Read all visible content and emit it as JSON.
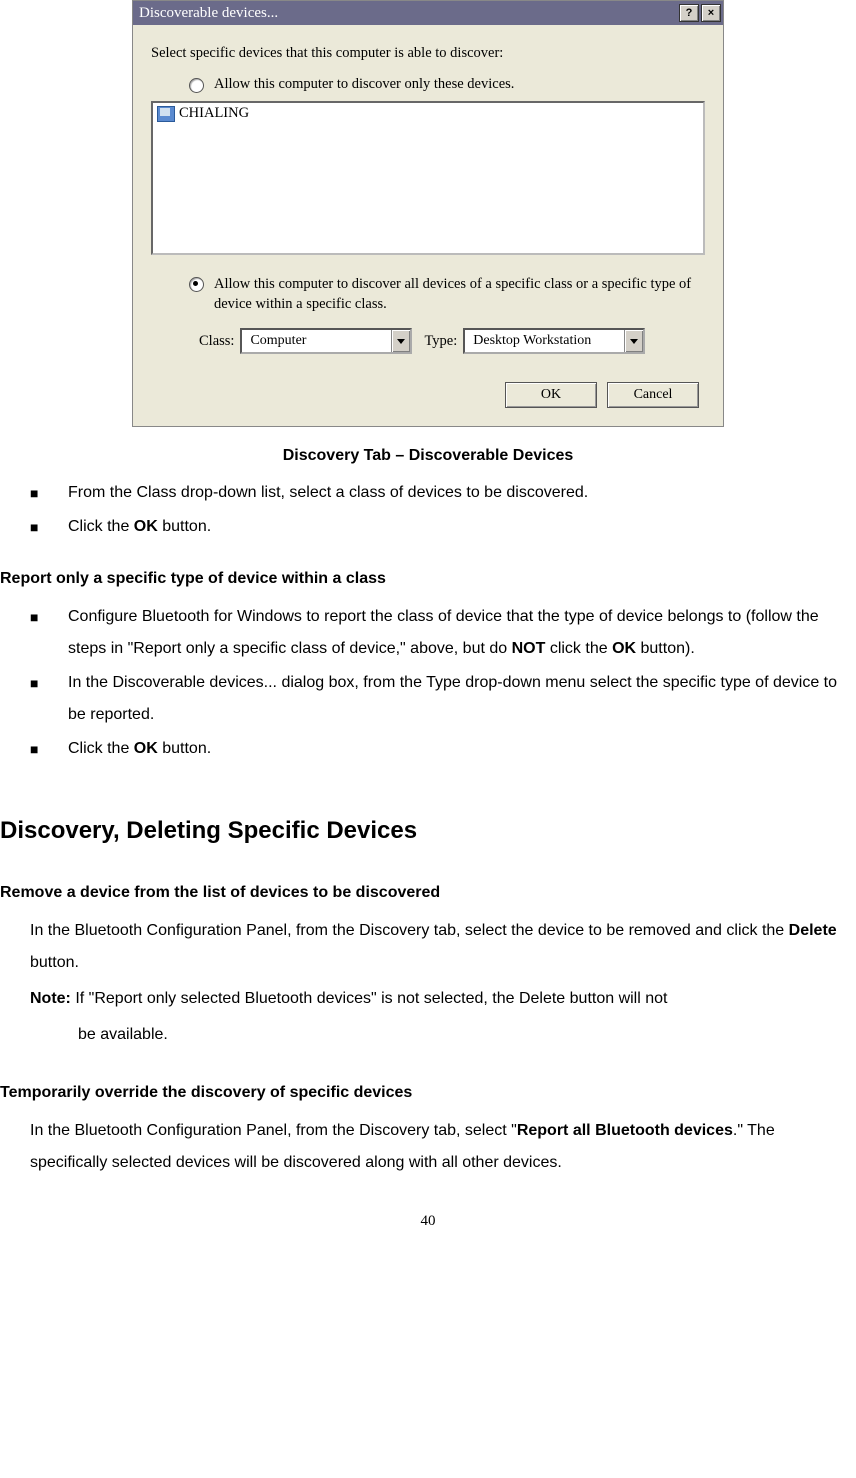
{
  "dialog": {
    "title": "Discoverable devices...",
    "help_btn": "?",
    "close_btn": "×",
    "instruction": "Select specific devices that this computer is able to discover:",
    "radio1": "Allow this computer to discover only these devices.",
    "device1": "CHIALING",
    "radio2": "Allow this computer to discover all devices of a specific class or a specific type of device within a specific class.",
    "class_label": "Class:",
    "class_value": "Computer",
    "type_label": "Type:",
    "type_value": "Desktop Workstation",
    "ok": "OK",
    "cancel": "Cancel"
  },
  "caption": "Discovery Tab – Discoverable Devices",
  "list1": {
    "item1": "From the Class drop-down list, select a class of devices to be discovered.",
    "item2_pre": "Click the ",
    "item2_bold": "OK",
    "item2_post": " button."
  },
  "subhead1": "Report only a specific type of device within a class",
  "list2": {
    "item1_pre": "Configure Bluetooth for Windows to report the class of device that the type of device belongs to (follow the steps in \"Report only a specific class of device,\" above, but do ",
    "item1_not": "NOT",
    "item1_mid": " click the ",
    "item1_ok": "OK",
    "item1_post": " button).",
    "item2": "In the Discoverable devices... dialog box, from the Type drop-down menu select the specific type of device to be reported.",
    "item3_pre": "Click the ",
    "item3_bold": "OK",
    "item3_post": " button."
  },
  "h2": "Discovery, Deleting Specific Devices",
  "subhead2": "Remove a device from the list of devices to be discovered",
  "para1_pre": "In the Bluetooth Configuration Panel, from the Discovery tab, select the device to be removed and click the ",
  "para1_bold": "Delete",
  "para1_post": " button.",
  "note_label": "Note:",
  "note_text": " If \"Report only selected Bluetooth devices\" is not selected, the Delete button will not",
  "note_text2": "be available.",
  "subhead3": "Temporarily override the discovery of specific devices",
  "para2_pre": "In the Bluetooth Configuration Panel, from the Discovery tab, select \"",
  "para2_bold": "Report all Bluetooth devices",
  "para2_post": ".\" The specifically selected devices will be discovered along with all other devices.",
  "pagenum": "40"
}
